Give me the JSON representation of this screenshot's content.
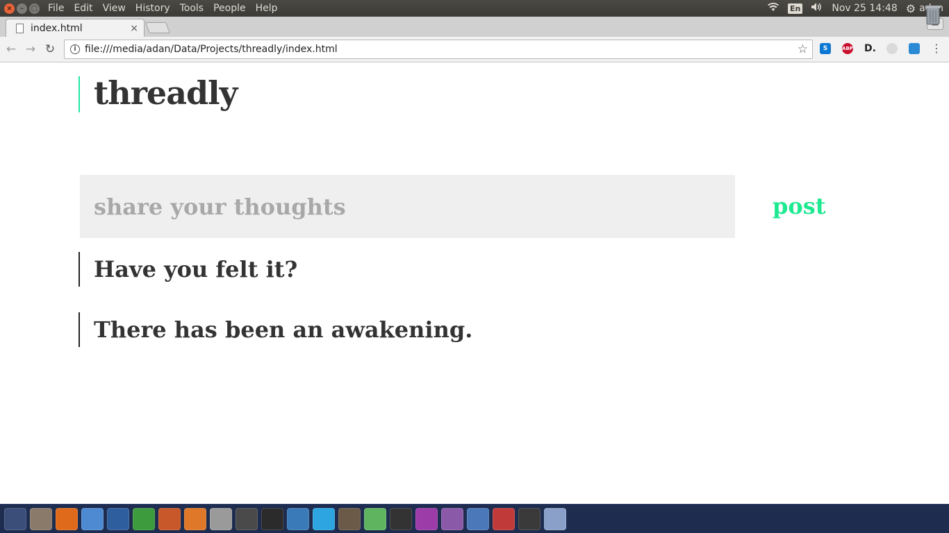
{
  "system_menu": [
    "File",
    "Edit",
    "View",
    "History",
    "Tools",
    "People",
    "Help"
  ],
  "tray": {
    "keyboard": "En",
    "datetime": "Nov 25 14:48",
    "user": "adan"
  },
  "tab": {
    "title": "index.html",
    "close": "×"
  },
  "toolbar": {
    "url": "file:///media/adan/Data/Projects/threadly/index.html"
  },
  "extensions": [
    {
      "name": "skype-icon",
      "label": "S",
      "color": "#0c78d4"
    },
    {
      "name": "adblock-icon",
      "label": "ABP",
      "color": "#c8102e"
    },
    {
      "name": "disconnect-icon",
      "label": "D.",
      "color": "#f2f2f2"
    },
    {
      "name": "shield-icon",
      "label": "",
      "color": "#dadada"
    },
    {
      "name": "reader-icon",
      "label": "",
      "color": "#2a8ad4"
    }
  ],
  "page": {
    "brand": "threadly",
    "composer_placeholder": "share your thoughts",
    "post_label": "post",
    "threads": [
      "Have you felt it?",
      "There has been an awakening."
    ]
  },
  "colors": {
    "accent": "#1de990",
    "brand_bar": "#1de9a6",
    "text": "#333333"
  },
  "dock": [
    {
      "name": "ubuntu-dash-icon",
      "color": "#3b4e7a"
    },
    {
      "name": "files-icon",
      "color": "#8a7a6a"
    },
    {
      "name": "firefox-icon",
      "color": "#e06a1b"
    },
    {
      "name": "chromium-icon",
      "color": "#4e8ad2"
    },
    {
      "name": "writer-doc-icon",
      "color": "#2f5e9e"
    },
    {
      "name": "calc-icon",
      "color": "#3d9a3d"
    },
    {
      "name": "impress-icon",
      "color": "#c8582a"
    },
    {
      "name": "software-center-icon",
      "color": "#e0782a"
    },
    {
      "name": "settings-icon",
      "color": "#9a9a9a"
    },
    {
      "name": "sublime-icon",
      "color": "#4a4a4a"
    },
    {
      "name": "terminal-icon",
      "color": "#2b2b2b"
    },
    {
      "name": "spiral-app-icon",
      "color": "#3a7ab8"
    },
    {
      "name": "telegram-icon",
      "color": "#2ca5e0"
    },
    {
      "name": "gimp-icon",
      "color": "#6b5a48"
    },
    {
      "name": "atom-icon",
      "color": "#5fb45f"
    },
    {
      "name": "inkscape-icon",
      "color": "#333333"
    },
    {
      "name": "window-app-icon",
      "color": "#9b3ca8"
    },
    {
      "name": "pidgin-icon",
      "color": "#8a5aa8"
    },
    {
      "name": "virtualbox-icon",
      "color": "#4a78b8"
    },
    {
      "name": "usb-creator-icon",
      "color": "#c03a3a"
    },
    {
      "name": "workspace-switcher-icon",
      "color": "#3a3a3a"
    },
    {
      "name": "drive-icon",
      "color": "#8aa0c8"
    }
  ]
}
